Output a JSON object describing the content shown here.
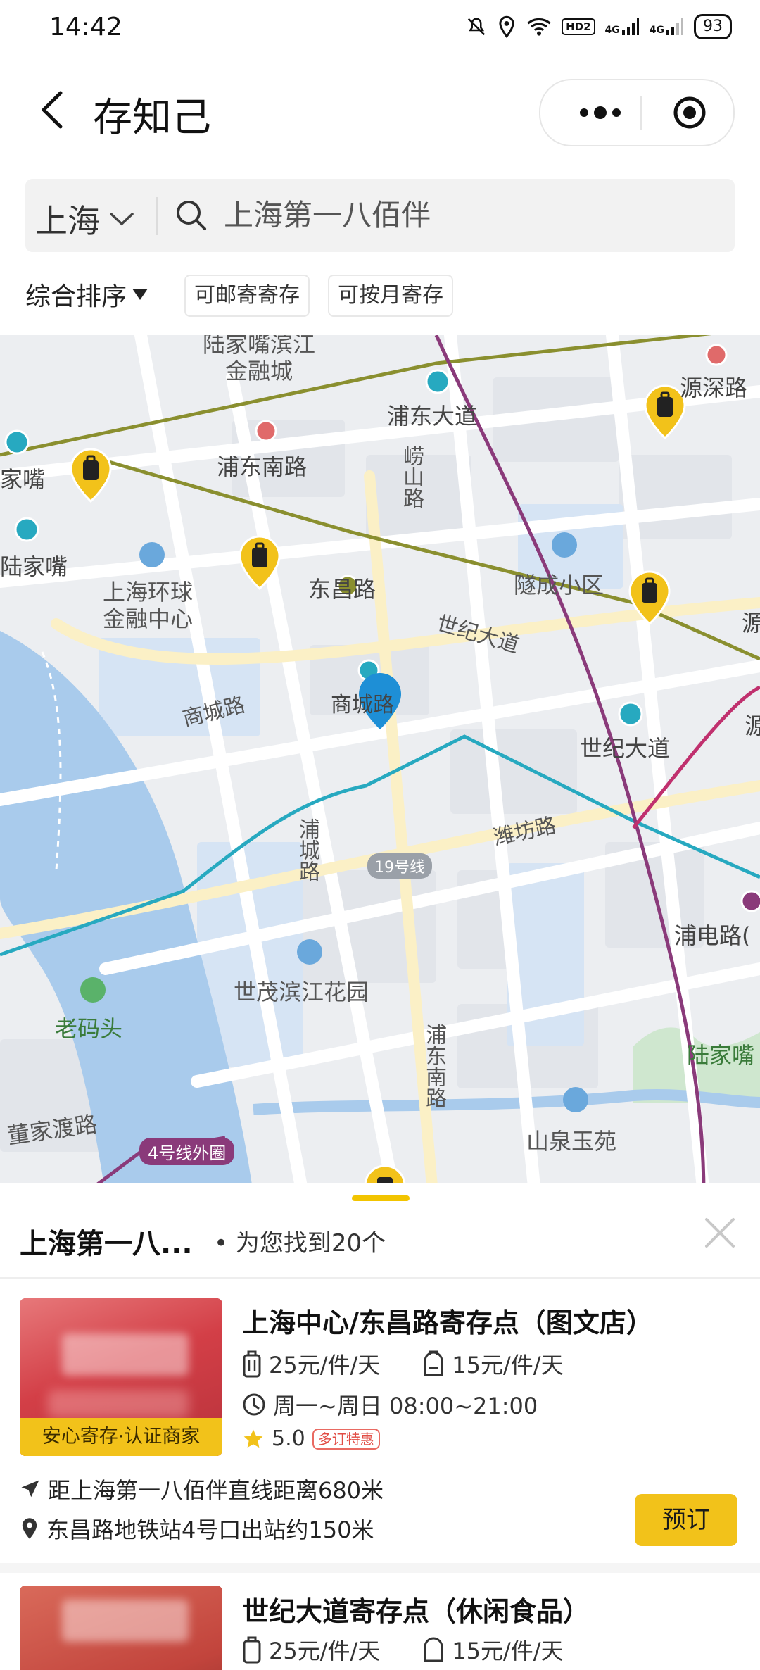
{
  "status_bar": {
    "time": "14:42",
    "network_badge": "HD2",
    "signal_1": "4G",
    "signal_2": "4G",
    "battery": "93"
  },
  "header": {
    "title": "存知己"
  },
  "search": {
    "city": "上海",
    "query": "上海第一八佰伴"
  },
  "filters": {
    "sort_label": "综合排序",
    "chip_1": "可邮寄寄存",
    "chip_2": "可按月寄存"
  },
  "map": {
    "labels": {
      "l1": "陆家嘴滨江",
      "l2": "金融城",
      "l3": "浦东大道",
      "l4": "源深路",
      "l5": "家嘴",
      "l6": "浦东南路",
      "l7": "崂山路",
      "l8": "陆家嘴",
      "l9": "上海环球",
      "l10": "金融中心",
      "l11": "东昌路",
      "l12": "隧成小区",
      "l13": "世纪大道",
      "l14": "源",
      "l15": "商城路",
      "l16": "商城路",
      "l17": "世纪大道",
      "l18": "源",
      "l19": "潍坊路",
      "l20": "浦城路",
      "l21": "浦电路(",
      "l22": "世茂滨江花园",
      "l23": "老码头",
      "l24": "浦东南路",
      "l25": "陆家嘴",
      "l26": "董家渡路",
      "l27": "山泉玉苑",
      "line19": "19号线",
      "line4": "4号线外圈"
    }
  },
  "results": {
    "query_short": "上海第一八...",
    "count_text": "• 为您找到20个",
    "stores": [
      {
        "name": "上海中心/东昌路寄存点（图文店）",
        "badge": "安心寄存·认证商家",
        "price_large": "25元/件/天",
        "price_small": "15元/件/天",
        "hours": "周一~周日 08:00~21:00",
        "rating": "5.0",
        "promo": "多订特惠",
        "distance": "距上海第一八佰伴直线距离680米",
        "address": "东昌路地铁站4号口出站约150米",
        "book_label": "预订"
      },
      {
        "name": "世纪大道寄存点（休闲食品）",
        "price_large": "25元/件/天",
        "price_small": "15元/件/天"
      }
    ]
  },
  "colors": {
    "accent_yellow": "#f2c21a",
    "metro_teal": "#27a9c0",
    "metro_olive": "#8a8f2f",
    "metro_purple": "#8a3a7a",
    "pin_blue": "#1e8fd6",
    "water": "#a9cbec"
  },
  "icons": {
    "back": "back-arrow-icon",
    "more": "more-dots-icon",
    "target": "target-icon",
    "search": "search-icon",
    "close": "close-icon",
    "luggage": "luggage-icon",
    "backpack": "backpack-icon",
    "clock": "clock-icon",
    "star": "star-icon",
    "navigation": "navigation-icon",
    "location": "location-pin-icon"
  }
}
